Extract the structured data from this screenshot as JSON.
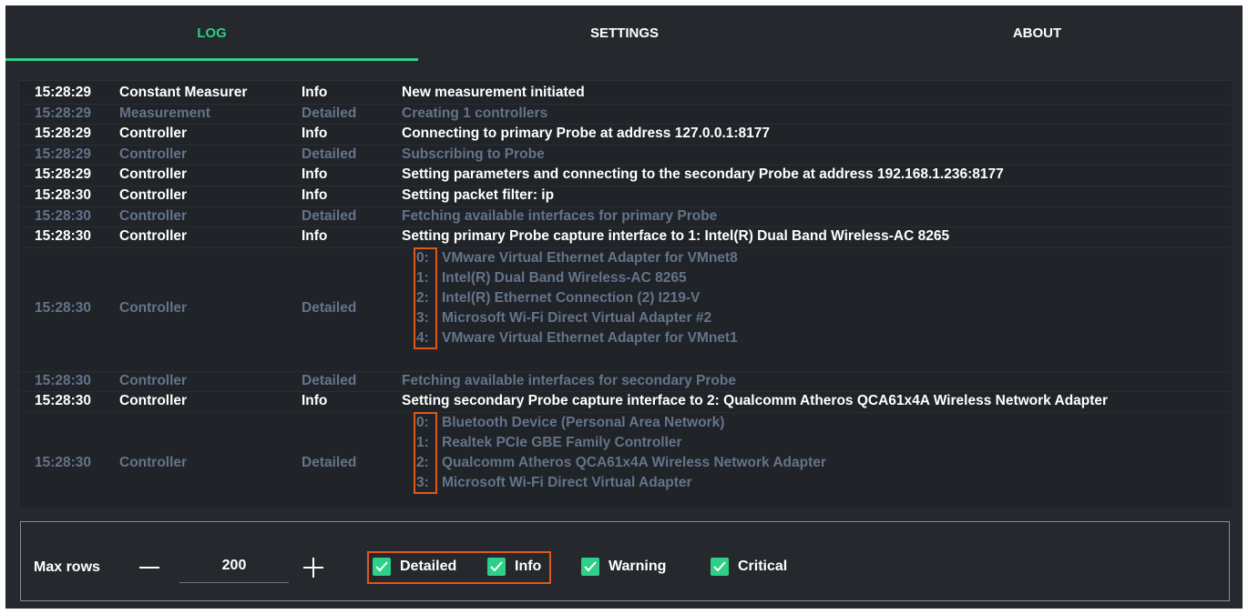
{
  "tabs": [
    {
      "label": "LOG"
    },
    {
      "label": "SETTINGS"
    },
    {
      "label": "ABOUT"
    }
  ],
  "log_rows": [
    {
      "time": "15:28:29",
      "source": "Constant Measurer",
      "level": "Info",
      "message": "New measurement initiated"
    },
    {
      "time": "15:28:29",
      "source": "Measurement",
      "level": "Detailed",
      "message": "Creating 1 controllers"
    },
    {
      "time": "15:28:29",
      "source": "Controller",
      "level": "Info",
      "message": "Connecting to primary Probe at address 127.0.0.1:8177"
    },
    {
      "time": "15:28:29",
      "source": "Controller",
      "level": "Detailed",
      "message": "Subscribing to Probe"
    },
    {
      "time": "15:28:29",
      "source": "Controller",
      "level": "Info",
      "message": "Setting parameters and connecting to the secondary Probe at address 192.168.1.236:8177"
    },
    {
      "time": "15:28:30",
      "source": "Controller",
      "level": "Info",
      "message": "Setting packet filter: ip"
    },
    {
      "time": "15:28:30",
      "source": "Controller",
      "level": "Detailed",
      "message": "Fetching available interfaces for primary Probe"
    },
    {
      "time": "15:28:30",
      "source": "Controller",
      "level": "Info",
      "message": "Setting primary Probe capture interface to 1: Intel(R) Dual Band Wireless-AC 8265"
    },
    {
      "time": "15:28:30",
      "source": "Controller",
      "level": "Detailed",
      "lines": [
        {
          "idx": "0:",
          "text": "VMware Virtual Ethernet Adapter for VMnet8"
        },
        {
          "idx": "1:",
          "text": "Intel(R) Dual Band Wireless-AC 8265"
        },
        {
          "idx": "2:",
          "text": "Intel(R) Ethernet Connection (2) I219-V"
        },
        {
          "idx": "3:",
          "text": "Microsoft Wi-Fi Direct Virtual Adapter #2"
        },
        {
          "idx": "4:",
          "text": "VMware Virtual Ethernet Adapter for VMnet1"
        }
      ]
    },
    {
      "time": "15:28:30",
      "source": "Controller",
      "level": "Detailed",
      "message": "Fetching available interfaces for secondary Probe"
    },
    {
      "time": "15:28:30",
      "source": "Controller",
      "level": "Info",
      "message": "Setting secondary Probe capture interface to 2: Qualcomm Atheros QCA61x4A Wireless Network Adapter"
    },
    {
      "time": "15:28:30",
      "source": "Controller",
      "level": "Detailed",
      "lines": [
        {
          "idx": "0:",
          "text": "Bluetooth Device (Personal Area Network)"
        },
        {
          "idx": "1:",
          "text": "Realtek PCIe GBE Family Controller"
        },
        {
          "idx": "2:",
          "text": "Qualcomm Atheros QCA61x4A Wireless Network Adapter"
        },
        {
          "idx": "3:",
          "text": "Microsoft Wi-Fi Direct Virtual Adapter"
        }
      ]
    }
  ],
  "controls": {
    "max_rows_label": "Max rows",
    "max_rows_value": "200",
    "filters": [
      {
        "label": "Detailed",
        "checked": true
      },
      {
        "label": "Info",
        "checked": true
      },
      {
        "label": "Warning",
        "checked": true
      },
      {
        "label": "Critical",
        "checked": true
      }
    ]
  },
  "colors": {
    "accent": "#2ecf86",
    "background": "#25282c",
    "dim_text": "#64748a",
    "highlight_box": "#e0581c"
  }
}
